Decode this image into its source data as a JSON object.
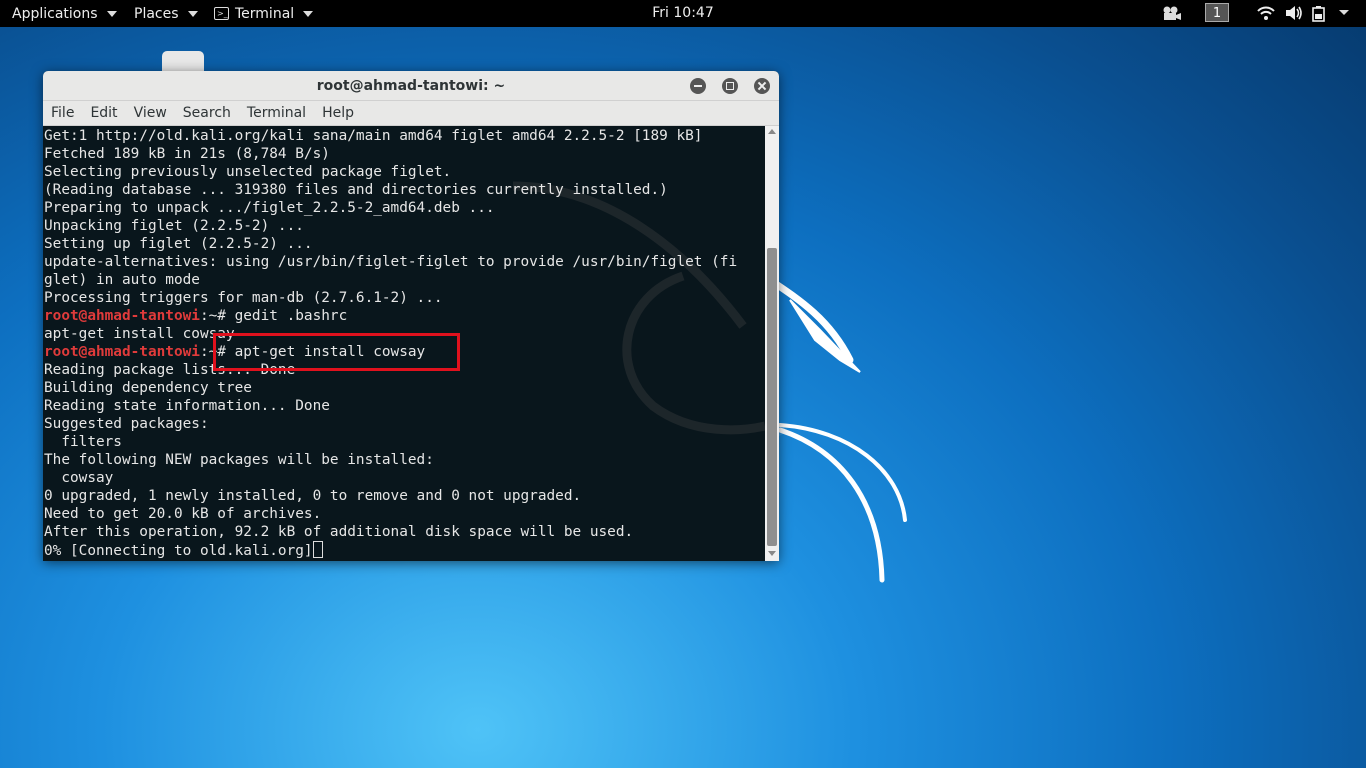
{
  "panel": {
    "applications_label": "Applications",
    "places_label": "Places",
    "terminal_label": "Terminal",
    "clock": "Fri 10:47",
    "workspace_number": "1"
  },
  "window": {
    "title": "root@ahmad-tantowi: ~",
    "menu": [
      "File",
      "Edit",
      "View",
      "Search",
      "Terminal",
      "Help"
    ]
  },
  "terminal": {
    "lines": [
      {
        "text": "Get:1 http://old.kali.org/kali sana/main amd64 figlet amd64 2.2.5-2 [189 kB]"
      },
      {
        "text": "Fetched 189 kB in 21s (8,784 B/s)"
      },
      {
        "text": "Selecting previously unselected package figlet."
      },
      {
        "text": "(Reading database ... 319380 files and directories currently installed.)"
      },
      {
        "text": "Preparing to unpack .../figlet_2.2.5-2_amd64.deb ..."
      },
      {
        "text": "Unpacking figlet (2.2.5-2) ..."
      },
      {
        "text": "Setting up figlet (2.2.5-2) ..."
      },
      {
        "text": "update-alternatives: using /usr/bin/figlet-figlet to provide /usr/bin/figlet (fi"
      },
      {
        "text": "glet) in auto mode"
      },
      {
        "text": "Processing triggers for man-db (2.7.6.1-2) ..."
      },
      {
        "user": "root@ahmad-tantowi",
        "text": ":~# gedit .bashrc"
      },
      {
        "text": "apt-get install cowsay"
      },
      {
        "user": "root@ahmad-tantowi",
        "text": ":~# apt-get install cowsay"
      },
      {
        "text": "Reading package lists... Done"
      },
      {
        "text": "Building dependency tree"
      },
      {
        "text": "Reading state information... Done"
      },
      {
        "text": "Suggested packages:"
      },
      {
        "text": "  filters"
      },
      {
        "text": "The following NEW packages will be installed:"
      },
      {
        "text": "  cowsay"
      },
      {
        "text": "0 upgraded, 1 newly installed, 0 to remove and 0 not upgraded."
      },
      {
        "text": "Need to get 20.0 kB of archives."
      },
      {
        "text": "After this operation, 92.2 kB of additional disk space will be used."
      },
      {
        "text": "0% [Connecting to old.kali.org]",
        "cursor": true
      }
    ]
  },
  "colors": {
    "prompt_user": "#e03b3b",
    "highlight_box": "#e0111d",
    "terminal_bg": "#0f1a20"
  },
  "icons": [
    "terminal-app-icon",
    "video-camera-icon",
    "wifi-icon",
    "volume-icon",
    "battery-icon",
    "kali-dragon-logo"
  ]
}
